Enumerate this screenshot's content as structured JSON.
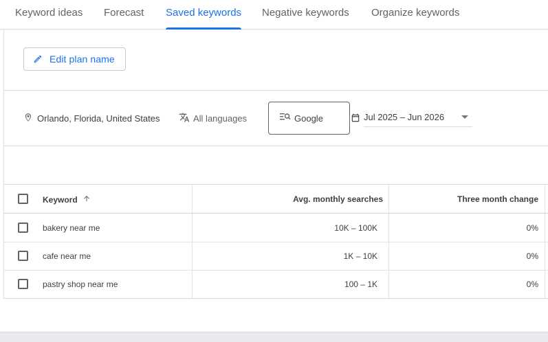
{
  "tabs": [
    {
      "label": "Keyword ideas"
    },
    {
      "label": "Forecast"
    },
    {
      "label": "Saved keywords",
      "active": true
    },
    {
      "label": "Negative keywords"
    },
    {
      "label": "Organize keywords"
    }
  ],
  "edit_plan": {
    "label": "Edit plan name",
    "icon": "pencil-icon"
  },
  "filters": {
    "location": {
      "label": "Orlando, Florida, United States",
      "icon": "location-pin-icon"
    },
    "language": {
      "label": "All languages",
      "icon": "translate-icon"
    },
    "network": {
      "label": "Google",
      "icon": "search-network-icon"
    },
    "date_range": {
      "label": "Jul 2025 – Jun 2026",
      "icon": "calendar-icon"
    }
  },
  "table": {
    "columns": {
      "keyword": "Keyword",
      "avg_monthly_searches": "Avg. monthly searches",
      "three_month_change": "Three month change"
    },
    "rows": [
      {
        "keyword": "bakery near me",
        "avg_monthly_searches": "10K – 100K",
        "three_month_change": "0%"
      },
      {
        "keyword": "cafe near me",
        "avg_monthly_searches": "1K – 10K",
        "three_month_change": "0%"
      },
      {
        "keyword": "pastry shop near me",
        "avg_monthly_searches": "100 – 1K",
        "three_month_change": "0%"
      }
    ]
  },
  "colors": {
    "accent": "#1a73e8",
    "text": "#3c4043",
    "muted": "#5f6368",
    "divider": "#dadce0"
  }
}
